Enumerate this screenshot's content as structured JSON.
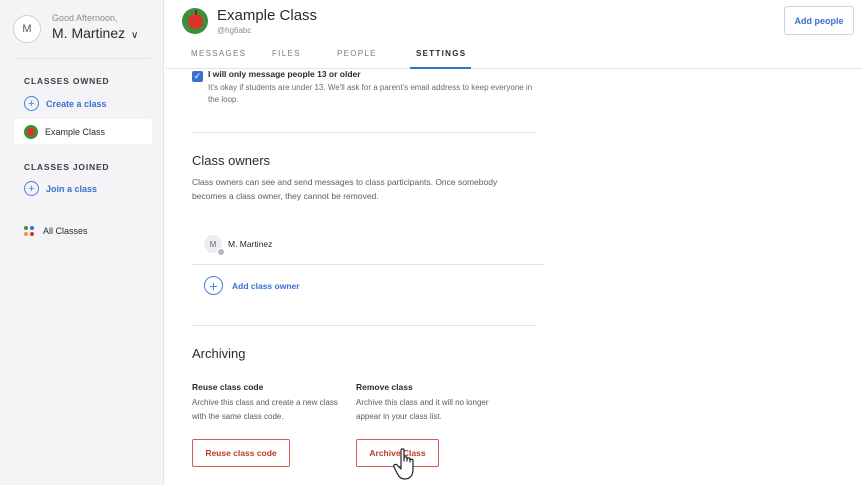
{
  "sidebar": {
    "avatar_initial": "M",
    "greeting": "Good Afternoon,",
    "user_name": "M. Martinez",
    "user_chevron": "∨",
    "owned_label": "CLASSES OWNED",
    "create_class": "Create a class",
    "example_class": "Example Class",
    "joined_label": "CLASSES JOINED",
    "join_class": "Join a class",
    "all_classes": "All Classes"
  },
  "header": {
    "class_title": "Example Class",
    "class_code": "@hg6abc",
    "tabs": [
      {
        "label": "MESSAGES"
      },
      {
        "label": "FILES"
      },
      {
        "label": "PEOPLE"
      },
      {
        "label": "SETTINGS"
      }
    ],
    "active_tab": "SETTINGS",
    "add_people": "Add people"
  },
  "settings": {
    "age_checkbox_label": "I will only message people 13 or older",
    "age_checkbox_checked": true,
    "age_checkbox_desc": "It's okay if students are under 13. We'll ask for a parent's email address to keep everyone in the loop.",
    "owners_title": "Class owners",
    "owners_desc": "Class owners can see and send messages to class participants. Once somebody becomes a class owner, they cannot be removed.",
    "owner_initial": "M",
    "owner_name": "M. Martinez",
    "add_owner": "Add class owner",
    "archiving_title": "Archiving",
    "reuse_head": "Reuse class code",
    "reuse_desc": "Archive this class and create a new class with the same class code.",
    "reuse_button": "Reuse class code",
    "remove_head": "Remove class",
    "remove_desc": "Archive this class and it will no longer appear in your class list.",
    "archive_button": "Archive Class"
  },
  "colors": {
    "accent": "#3a6fd0",
    "danger": "#c0392b",
    "sidebar_bg": "#f4f4f6"
  },
  "icons": {
    "plus": "+",
    "check": "✓"
  }
}
